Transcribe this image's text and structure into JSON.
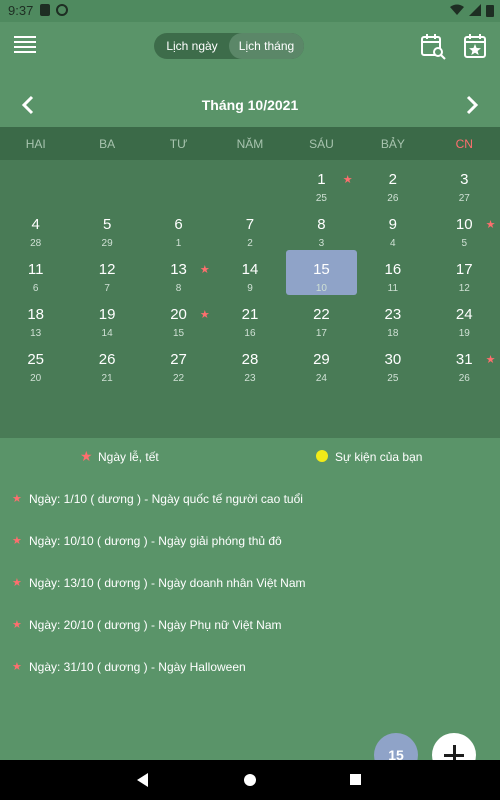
{
  "status_bar": {
    "time": "9:37"
  },
  "app_bar": {
    "toggle_day": "Lịch ngày",
    "toggle_month": "Lịch tháng"
  },
  "month_nav": {
    "title": "Tháng 10/2021"
  },
  "weekdays": [
    "HAI",
    "BA",
    "TƯ",
    "NĂM",
    "SÁU",
    "BẢY",
    "CN"
  ],
  "weekday_sunday_color": "#ff6e6e",
  "weeks": [
    [
      null,
      null,
      null,
      null,
      {
        "d": "1",
        "l": "25",
        "star": true
      },
      {
        "d": "2",
        "l": "26"
      },
      {
        "d": "3",
        "l": "27"
      }
    ],
    [
      {
        "d": "4",
        "l": "28"
      },
      {
        "d": "5",
        "l": "29"
      },
      {
        "d": "6",
        "l": "1"
      },
      {
        "d": "7",
        "l": "2"
      },
      {
        "d": "8",
        "l": "3"
      },
      {
        "d": "9",
        "l": "4"
      },
      {
        "d": "10",
        "l": "5",
        "star": true
      }
    ],
    [
      {
        "d": "11",
        "l": "6"
      },
      {
        "d": "12",
        "l": "7"
      },
      {
        "d": "13",
        "l": "8",
        "star": true
      },
      {
        "d": "14",
        "l": "9"
      },
      {
        "d": "15",
        "l": "10",
        "selected": true
      },
      {
        "d": "16",
        "l": "11"
      },
      {
        "d": "17",
        "l": "12"
      }
    ],
    [
      {
        "d": "18",
        "l": "13"
      },
      {
        "d": "19",
        "l": "14"
      },
      {
        "d": "20",
        "l": "15",
        "star": true
      },
      {
        "d": "21",
        "l": "16"
      },
      {
        "d": "22",
        "l": "17"
      },
      {
        "d": "23",
        "l": "18"
      },
      {
        "d": "24",
        "l": "19"
      }
    ],
    [
      {
        "d": "25",
        "l": "20"
      },
      {
        "d": "26",
        "l": "21"
      },
      {
        "d": "27",
        "l": "22"
      },
      {
        "d": "28",
        "l": "23"
      },
      {
        "d": "29",
        "l": "24"
      },
      {
        "d": "30",
        "l": "25"
      },
      {
        "d": "31",
        "l": "26",
        "star": true
      }
    ]
  ],
  "legend": {
    "holiday": "Ngày lễ, tết",
    "event": "Sự kiện của bạn"
  },
  "events": [
    "Ngày: 1/10 ( dương ) - Ngày quốc tế người cao tuổi",
    "Ngày: 10/10 ( dương ) - Ngày giải phóng thủ đô",
    "Ngày: 13/10 ( dương ) - Ngày doanh nhân Việt Nam",
    "Ngày: 20/10 ( dương ) - Ngày Phụ nữ Việt Nam",
    "Ngày: 31/10 ( dương ) - Ngày Halloween"
  ],
  "fab": {
    "today": "15"
  },
  "colors": {
    "background": "#5a9469",
    "holiday_star": "#ff6e6e",
    "selected_day": "#8fa3c8",
    "event_dot": "#f2eb18"
  }
}
